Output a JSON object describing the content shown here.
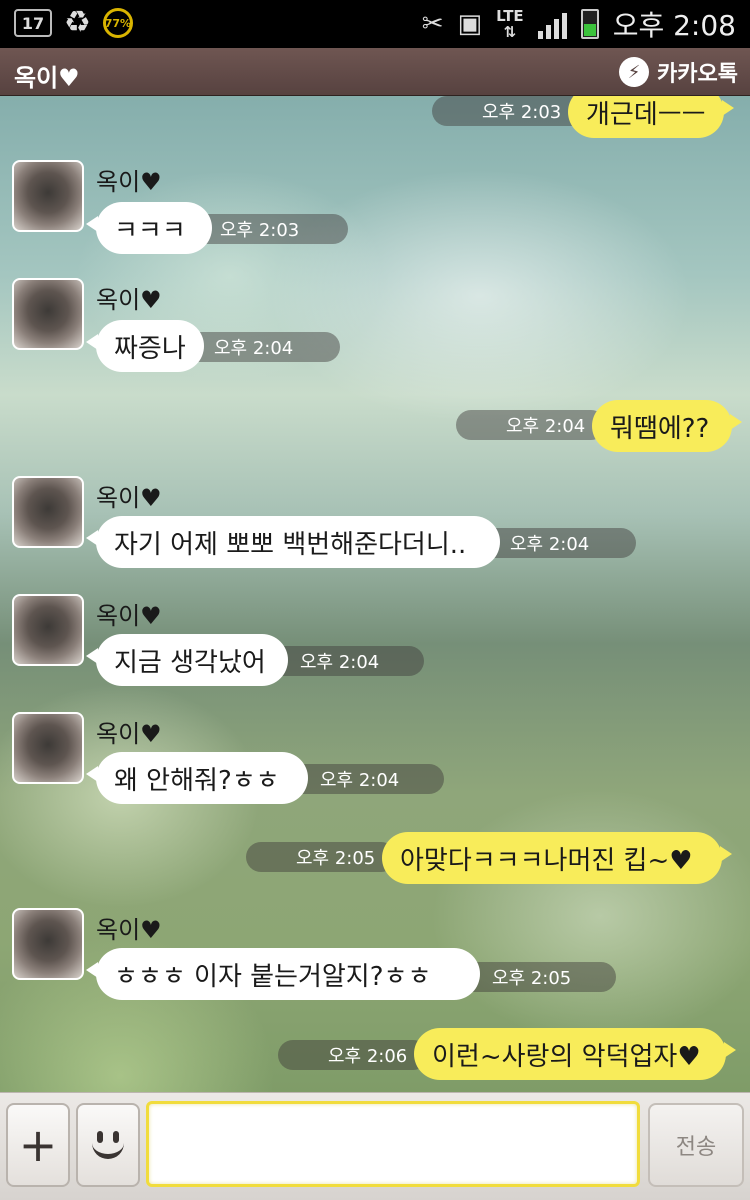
{
  "status_bar": {
    "notification_badge": "17",
    "battery_percent": "77%",
    "network": "LTE",
    "clock": "오후 2:08"
  },
  "header": {
    "chat_name": "옥이♥",
    "app_name": "카카오톡"
  },
  "messages": [
    {
      "side": "out",
      "text": "개근데ㅡㅡ",
      "time": "오후 2:03"
    },
    {
      "side": "in",
      "sender": "옥이♥",
      "text": "ㅋㅋㅋ",
      "time": "오후 2:03"
    },
    {
      "side": "in",
      "sender": "옥이♥",
      "text": "짜증나",
      "time": "오후 2:04"
    },
    {
      "side": "out",
      "text": "뭐땜에??",
      "time": "오후 2:04"
    },
    {
      "side": "in",
      "sender": "옥이♥",
      "text": "자기 어제 뽀뽀 백번해준다더니..",
      "time": "오후 2:04"
    },
    {
      "side": "in",
      "sender": "옥이♥",
      "text": "지금 생각났어",
      "time": "오후 2:04"
    },
    {
      "side": "in",
      "sender": "옥이♥",
      "text": "왜 안해줘?ㅎㅎ",
      "time": "오후 2:04"
    },
    {
      "side": "out",
      "text": "아맞다ㅋㅋㅋ나머진 킵~♥",
      "time": "오후 2:05"
    },
    {
      "side": "in",
      "sender": "옥이♥",
      "text": "ㅎㅎㅎ 이자 붙는거알지?ㅎㅎ",
      "time": "오후 2:05"
    },
    {
      "side": "out",
      "text": "이런~사랑의 악덕업자♥",
      "time": "오후 2:06"
    }
  ],
  "input_bar": {
    "plus_label": "+",
    "message_value": "",
    "send_label": "전송"
  }
}
